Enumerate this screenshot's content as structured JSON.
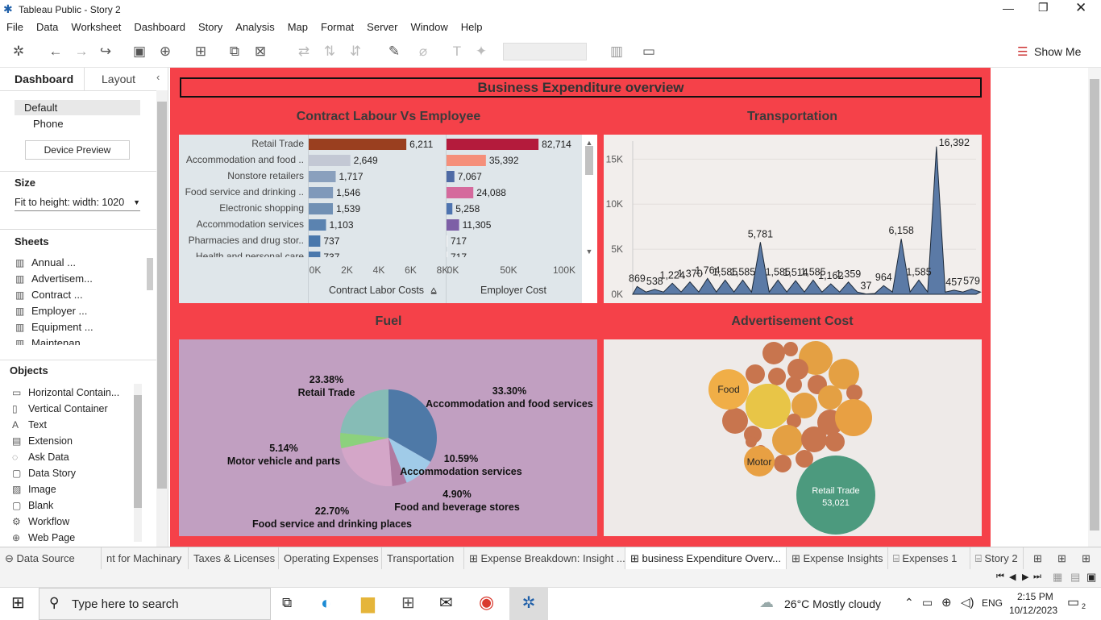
{
  "app": {
    "title": "Tableau Public - Story 2"
  },
  "menu": [
    "File",
    "Data",
    "Worksheet",
    "Dashboard",
    "Story",
    "Analysis",
    "Map",
    "Format",
    "Server",
    "Window",
    "Help"
  ],
  "toolbar": {
    "show_me": "Show Me"
  },
  "left_panel": {
    "tab_dashboard": "Dashboard",
    "tab_layout": "Layout",
    "device_default": "Default",
    "device_phone": "Phone",
    "device_preview": "Device Preview",
    "size_label": "Size",
    "size_value": "Fit to height: width: 1020",
    "sheets_label": "Sheets",
    "sheets": [
      "Annual ...",
      "Advertisem...",
      "Contract ...",
      "Employer ...",
      "Equipment ...",
      "Maintenan..."
    ],
    "objects_label": "Objects",
    "objects": [
      "Horizontal Contain...",
      "Vertical Container",
      "Text",
      "Extension",
      "Ask Data",
      "Data Story",
      "Image",
      "Blank",
      "Workflow",
      "Web Page"
    ]
  },
  "dashboard": {
    "title": "Business Expenditure overview",
    "panel_contract": "Contract Labour Vs Employee",
    "panel_transport": "Transportation",
    "panel_fuel": "Fuel",
    "panel_advert": "Advertisement Cost"
  },
  "contract_chart": {
    "categories": [
      "Retail Trade",
      "Accommodation and food ..",
      "Nonstore retailers",
      "Food service and drinking ..",
      "Electronic shopping",
      "Accommodation services",
      "Pharmacies and drug stor..",
      "Health and personal care"
    ],
    "labor_values": [
      6211,
      2649,
      1717,
      1546,
      1539,
      1103,
      737,
      737
    ],
    "labor_labels": [
      "6,211",
      "2,649",
      "1,717",
      "1,546",
      "1,539",
      "1,103",
      "737",
      "737"
    ],
    "employer_values": [
      82714,
      35392,
      7067,
      24088,
      5258,
      11305,
      717,
      717
    ],
    "employer_labels": [
      "82,714",
      "35,392",
      "7,067",
      "24,088",
      "5,258",
      "11,305",
      "717",
      "717"
    ],
    "labor_ticks": [
      "0K",
      "2K",
      "4K",
      "6K",
      "8K"
    ],
    "employer_ticks": [
      "0K",
      "50K",
      "100K"
    ],
    "labor_axis": "Contract Labor Costs",
    "employer_axis": "Employer Cost",
    "labor_colors": [
      "#9a3f1f",
      "#c3c8d4",
      "#8aa0bd",
      "#7f99ba",
      "#7090b4",
      "#5b83b0",
      "#4a78ac",
      "#4a78ac"
    ],
    "employer_colors": [
      "#b41b3c",
      "#f58f7a",
      "#4e6aa5",
      "#d56a9d",
      "#4e74b0",
      "#7d5fa6",
      "#fff",
      "#fff"
    ]
  },
  "transport_chart": {
    "yticks": [
      "15K",
      "10K",
      "5K",
      "0K"
    ],
    "values": [
      869,
      538,
      1224,
      1370,
      1764,
      1585,
      1585,
      5781,
      1585,
      1514,
      1585,
      1162,
      1359,
      37,
      964,
      6158,
      1585,
      16392,
      457,
      579
    ],
    "labels": [
      "869",
      "538",
      "1,224",
      "1,370",
      "1,764",
      "1,585",
      "1,585",
      "5,781",
      "1,585",
      "1,514",
      "1,585",
      "1,162",
      "1,359",
      "37",
      "964",
      "6,158",
      "1,585",
      "16,392",
      "457",
      "579"
    ]
  },
  "fuel_chart": {
    "slices": [
      {
        "pct": "33.30%",
        "label": "Accommodation and food services",
        "value": 33.3,
        "color": "#4e79a7"
      },
      {
        "pct": "10.59%",
        "label": "Accommodation services",
        "value": 10.59,
        "color": "#a0cbe8"
      },
      {
        "pct": "4.90%",
        "label": "Food and beverage stores",
        "value": 4.9,
        "color": "#b07aa1"
      },
      {
        "pct": "22.70%",
        "label": "Food service and drinking places",
        "value": 22.7,
        "color": "#d4a6c8"
      },
      {
        "pct": "5.14%",
        "label": "Motor vehicle and parts",
        "value": 5.14,
        "color": "#8cd17d"
      },
      {
        "pct": "23.38%",
        "label": "Retail Trade",
        "value": 23.38,
        "color": "#86bcb6"
      }
    ]
  },
  "advert_chart": {
    "food": "Food",
    "motor": "Motor",
    "retail": "Retail Trade",
    "retail_value": "53,021"
  },
  "tabs": [
    "Data Source",
    "nt for Machinary",
    "Taxes & Licenses",
    "Operating Expenses",
    "Transportation",
    "Expense Breakdown: Insight ...",
    "business Expenditure Overv...",
    "Expense Insights",
    "Expenses 1",
    "Story 2"
  ],
  "taskbar": {
    "search": "Type here to search",
    "weather": "26°C  Mostly cloudy",
    "lang": "ENG",
    "time": "2:15 PM",
    "date": "10/12/2023",
    "notif": "2"
  }
}
